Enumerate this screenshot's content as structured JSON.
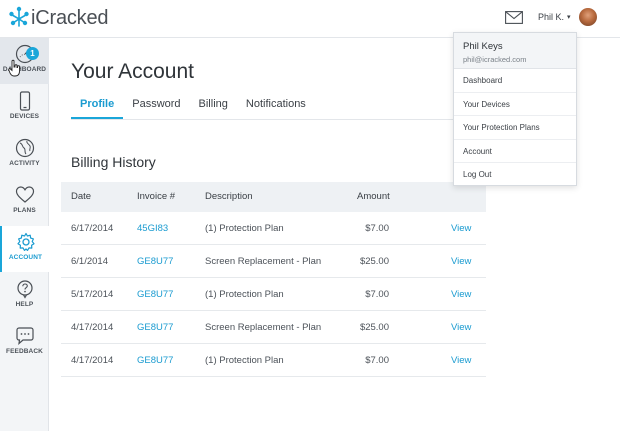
{
  "header": {
    "logo_text": "iCracked",
    "user_label": "Phil K.",
    "caret": "▾"
  },
  "sidebar": {
    "items": [
      {
        "label": "DASHBOARD",
        "badge": "1"
      },
      {
        "label": "DEVICES"
      },
      {
        "label": "ACTIVITY"
      },
      {
        "label": "PLANS"
      },
      {
        "label": "ACCOUNT"
      },
      {
        "label": "HELP"
      },
      {
        "label": "FEEDBACK"
      }
    ]
  },
  "main": {
    "title": "Your Account",
    "tabs": [
      "Profile",
      "Password",
      "Billing",
      "Notifications"
    ],
    "active_tab": "Profile",
    "section_title": "Billing History",
    "table": {
      "headers": [
        "Date",
        "Invoice #",
        "Description",
        "Amount"
      ],
      "rows": [
        {
          "date": "6/17/2014",
          "invoice": "45GI83",
          "description": "(1) Protection Plan",
          "amount": "$7.00",
          "action": "View"
        },
        {
          "date": "6/1/2014",
          "invoice": "GE8U77",
          "description": "Screen Replacement - Plan",
          "amount": "$25.00",
          "action": "View"
        },
        {
          "date": "5/17/2014",
          "invoice": "GE8U77",
          "description": "(1) Protection Plan",
          "amount": "$7.00",
          "action": "View"
        },
        {
          "date": "4/17/2014",
          "invoice": "GE8U77",
          "description": "Screen Replacement - Plan",
          "amount": "$25.00",
          "action": "View"
        },
        {
          "date": "4/17/2014",
          "invoice": "GE8U77",
          "description": "(1) Protection Plan",
          "amount": "$7.00",
          "action": "View"
        }
      ]
    }
  },
  "dropdown": {
    "name": "Phil Keys",
    "email": "phil@icracked.com",
    "items": [
      "Dashboard",
      "Your Devices",
      "Your Protection Plans",
      "Account",
      "Log Out"
    ]
  },
  "colors": {
    "accent": "#1aa6d9",
    "link": "#1a9bd0",
    "sidebar_bg": "#f3f5f7",
    "table_header_bg": "#eef1f4"
  },
  "icons": [
    "logo-icon",
    "mail-icon",
    "avatar",
    "dashboard-gauge-icon",
    "phone-icon",
    "globe-icon",
    "heart-icon",
    "gear-icon",
    "help-icon",
    "chat-bubble-icon",
    "hand-cursor-icon"
  ]
}
